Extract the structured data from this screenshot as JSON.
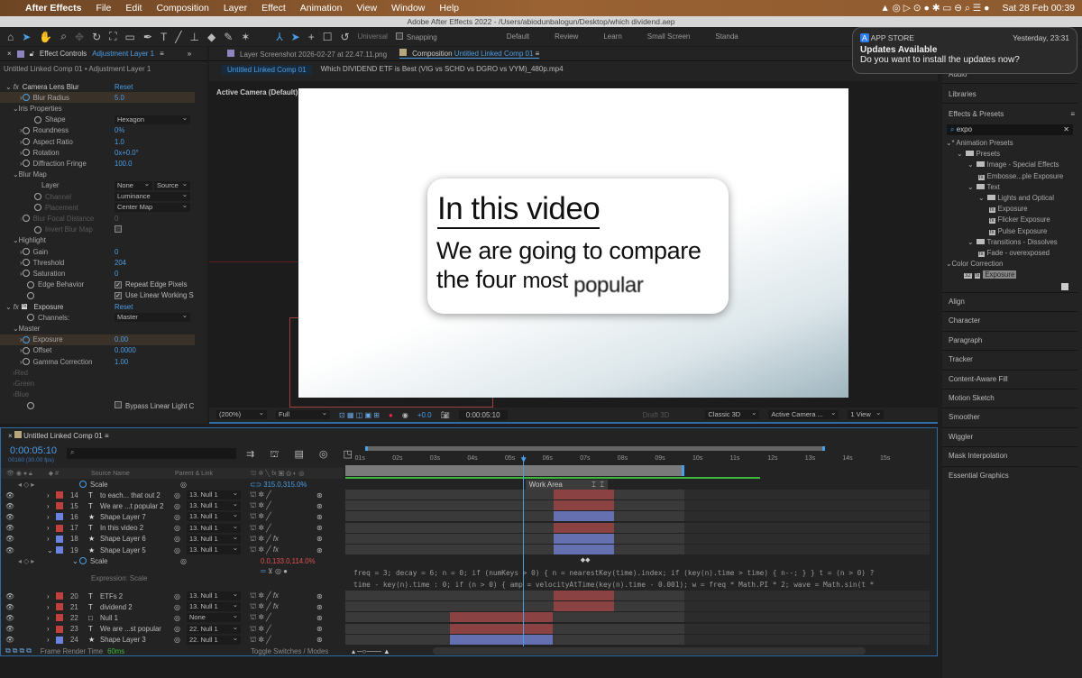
{
  "menubar": {
    "app": "After Effects",
    "items": [
      "File",
      "Edit",
      "Composition",
      "Layer",
      "Effect",
      "Animation",
      "View",
      "Window",
      "Help"
    ],
    "datetime": "Sat 28 Feb  00:39"
  },
  "window_title": "Adobe After Effects 2022 - /Users/abiodunbalogun/Desktop/which dividend.aep",
  "toolbar": {
    "universal": "Universal",
    "snapping": "Snapping",
    "workspaces": [
      "Default",
      "Review",
      "Learn",
      "Small Screen",
      "Standa"
    ]
  },
  "notification": {
    "app": "APP STORE",
    "time": "Yesterday, 23:31",
    "title": "Updates Available",
    "body": "Do you want to install the updates now?"
  },
  "effect_controls": {
    "tab": "Effect Controls",
    "layer": "Adjustment Layer 1",
    "subtitle": "Untitled Linked Comp 01 • Adjustment Layer 1",
    "rows": [
      {
        "label": "Camera Lens Blur",
        "kind": "fx",
        "value": "Reset",
        "indent": 0
      },
      {
        "label": "Blur Radius",
        "value": "5.0",
        "indent": 2,
        "arrow": true,
        "sw": "on",
        "hl": true
      },
      {
        "label": "Iris Properties",
        "kind": "group",
        "indent": 1
      },
      {
        "label": "Shape",
        "dropdown": "Hexagon",
        "indent": 3,
        "sw": true
      },
      {
        "label": "Roundness",
        "value": "0%",
        "indent": 2,
        "arrow": true,
        "sw": true
      },
      {
        "label": "Aspect Ratio",
        "value": "1.0",
        "indent": 2,
        "arrow": true,
        "sw": true
      },
      {
        "label": "Rotation",
        "value": "0x+0.0°",
        "indent": 2,
        "arrow": true,
        "sw": true
      },
      {
        "label": "Diffraction Fringe",
        "value": "100.0",
        "indent": 2,
        "arrow": true,
        "sw": true
      },
      {
        "label": "Blur Map",
        "kind": "group",
        "indent": 1
      },
      {
        "label": "Layer",
        "dropdown": "None",
        "dropdown2": "Source",
        "indent": 4
      },
      {
        "label": "Channel",
        "dropdown": "Luminance",
        "indent": 3,
        "sw": true,
        "dim": true
      },
      {
        "label": "Placement",
        "dropdown": "Center Map",
        "indent": 3,
        "sw": true,
        "dim": true
      },
      {
        "label": "Blur Focal Distance",
        "value": "0",
        "indent": 2,
        "arrow": true,
        "sw": true,
        "dim": true
      },
      {
        "label": "Invert Blur Map",
        "checkbox": "",
        "checked": false,
        "indent": 3,
        "sw": true,
        "dim": true
      },
      {
        "label": "Highlight",
        "kind": "group",
        "indent": 1
      },
      {
        "label": "Gain",
        "value": "0",
        "indent": 2,
        "arrow": true,
        "sw": true
      },
      {
        "label": "Threshold",
        "value": "204",
        "indent": 2,
        "arrow": true,
        "sw": true
      },
      {
        "label": "Saturation",
        "value": "0",
        "indent": 2,
        "arrow": true,
        "sw": true
      },
      {
        "label": "Edge Behavior",
        "checkbox": "Repeat Edge Pixels",
        "checked": true,
        "indent": 2,
        "sw": true
      },
      {
        "label": "",
        "checkbox": "Use Linear Working S",
        "checked": true,
        "indent": 2,
        "sw": true
      },
      {
        "label": "Exposure",
        "kind": "fx",
        "value": "Reset",
        "indent": 0
      },
      {
        "label": "Channels:",
        "dropdown": "Master",
        "indent": 2,
        "sw": true
      },
      {
        "label": "Master",
        "kind": "group",
        "indent": 1
      },
      {
        "label": "Exposure",
        "value": "0.00",
        "indent": 2,
        "arrow": true,
        "sw": "on",
        "hl": true
      },
      {
        "label": "Offset",
        "value": "0.0000",
        "indent": 2,
        "arrow": true,
        "sw": true
      },
      {
        "label": "Gamma Correction",
        "value": "1.00",
        "indent": 2,
        "arrow": true,
        "sw": true
      },
      {
        "label": "Red",
        "kind": "group",
        "collapsed": true,
        "indent": 1,
        "dim": true
      },
      {
        "label": "Green",
        "kind": "group",
        "collapsed": true,
        "indent": 1,
        "dim": true
      },
      {
        "label": "Blue",
        "kind": "group",
        "collapsed": true,
        "indent": 1,
        "dim": true
      },
      {
        "label": "",
        "checkbox": "Bypass Linear Light C",
        "checked": false,
        "indent": 2,
        "sw": true
      }
    ]
  },
  "composition": {
    "layer_tab": "Layer Screenshot 2026-02-27 at 22.47.11.png",
    "tab": "Composition",
    "comp_name": "Untitled Linked Comp 01",
    "breadcrumb": [
      "Untitled Linked Comp 01",
      "Which DIVIDEND ETF is Best (VIG vs SCHD vs DGRO vs VYM)_480p.mp4"
    ],
    "camera_label": "Active Camera (Default)",
    "card": {
      "title": "In this video",
      "line1": "We are going to compare",
      "line2a": "the four ",
      "line2b": "most ",
      "line2c": "popular"
    },
    "bottom": {
      "zoom": "(200%)",
      "resolution": "Full",
      "exposure": "+0.0",
      "timecode": "0:00:05:10",
      "draft3d": "Draft 3D",
      "renderer": "Classic 3D",
      "camera": "Active Camera ...",
      "views": "1 View"
    }
  },
  "right_panel": {
    "audio": "Audio",
    "libraries": "Libraries",
    "effects_presets": "Effects & Presets",
    "search": "expo",
    "tree": [
      {
        "label": "* Animation Presets",
        "level": 0,
        "type": "group"
      },
      {
        "label": "Presets",
        "level": 1,
        "type": "folder"
      },
      {
        "label": "Image - Special Effects",
        "level": 2,
        "type": "folder"
      },
      {
        "label": "Embosse...ple Exposure",
        "level": 3,
        "type": "preset"
      },
      {
        "label": "Text",
        "level": 2,
        "type": "folder"
      },
      {
        "label": "Lights and Optical",
        "level": 3,
        "type": "folder"
      },
      {
        "label": "Exposure",
        "level": 4,
        "type": "preset"
      },
      {
        "label": "Flicker Exposure",
        "level": 4,
        "type": "preset"
      },
      {
        "label": "Pulse Exposure",
        "level": 4,
        "type": "preset"
      },
      {
        "label": "Transitions - Dissolves",
        "level": 2,
        "type": "folder"
      },
      {
        "label": "Fade - overexposed",
        "level": 3,
        "type": "preset"
      },
      {
        "label": "Color Correction",
        "level": 0,
        "type": "group"
      },
      {
        "label": "Exposure",
        "level": 1,
        "type": "effect",
        "selected": true
      }
    ],
    "panels": [
      "Align",
      "Character",
      "Paragraph",
      "Tracker",
      "Content-Aware Fill",
      "Motion Sketch",
      "Smoother",
      "Wiggler",
      "Mask Interpolation",
      "Essential Graphics"
    ]
  },
  "timeline": {
    "tab": "Untitled Linked Comp 01",
    "timecode": "0:00:05:10",
    "frames": "00160 (30.00 fps)",
    "col_source": "Source Name",
    "col_parent": "Parent & Link",
    "current_time_s": 5.33,
    "work_area_end_s": 9.65,
    "work_area_label": "Work Area",
    "ticks": [
      "01s",
      "02s",
      "03s",
      "04s",
      "05s",
      "06s",
      "07s",
      "08s",
      "09s",
      "10s",
      "11s",
      "12s",
      "13s",
      "14s",
      "15s"
    ],
    "scale_row": {
      "label": "Scale",
      "value": "315.0,315.0%"
    },
    "layers": [
      {
        "num": "14",
        "type": "T",
        "name": "to each... that out 2",
        "parent": "13. Null 1",
        "color": "#c0403e",
        "bar": "red",
        "start": 6.15,
        "end": 7.77
      },
      {
        "num": "15",
        "type": "T",
        "name": "We are ...t popular 2",
        "parent": "13. Null 1",
        "color": "#c0403e",
        "bar": "red",
        "start": 6.15,
        "end": 7.77
      },
      {
        "num": "16",
        "type": "★",
        "name": "Shape Layer 7",
        "parent": "13. Null 1",
        "color": "#6b82e0",
        "bar": "blue",
        "start": 6.15,
        "end": 7.77
      },
      {
        "num": "17",
        "type": "T",
        "name": "In this video 2",
        "parent": "13. Null 1",
        "color": "#c0403e",
        "bar": "red",
        "start": 6.15,
        "end": 7.77
      },
      {
        "num": "18",
        "type": "★",
        "name": "Shape Layer 6",
        "parent": "13. Null 1",
        "color": "#6b82e0",
        "bar": "blue",
        "start": 6.15,
        "end": 7.77,
        "fx": true
      },
      {
        "num": "19",
        "type": "★",
        "name": "Shape Layer 5",
        "parent": "13. Null 1",
        "color": "#6b82e0",
        "bar": "blue",
        "start": 6.15,
        "end": 7.77,
        "fx": true,
        "expanded": true
      }
    ],
    "expr_row": {
      "label": "Scale",
      "value": "0.0,133.0,114.0%",
      "expression_label": "Expression: Scale",
      "code": [
        "freq = 3; decay = 6; n = 0; if (numKeys > 0) { n = nearestKey(time).index; if (key(n).time > time) { n--; } } t = (n > 0) ?",
        "time - key(n).time : 0; if (n > 0) { amp = velocityAtTime(key(n).time - 0.001); w = freq * Math.PI * 2; wave = Math.sin(t *"
      ]
    },
    "layers2": [
      {
        "num": "20",
        "type": "T",
        "name": "ETFs 2",
        "parent": "13. Null 1",
        "color": "#c0403e",
        "bar": "red",
        "start": 6.15,
        "end": 7.77,
        "fx": true
      },
      {
        "num": "21",
        "type": "T",
        "name": "dividend 2",
        "parent": "13. Null 1",
        "color": "#c0403e",
        "bar": "red",
        "start": 6.15,
        "end": 7.77,
        "fx": true
      },
      {
        "num": "22",
        "type": "□",
        "name": "Null 1",
        "parent": "None",
        "color": "#c0403e",
        "bar": "red",
        "start": 3.4,
        "end": 6.13
      },
      {
        "num": "23",
        "type": "T",
        "name": "We are ...st popular",
        "parent": "22. Null 1",
        "color": "#c0403e",
        "bar": "red",
        "start": 3.4,
        "end": 6.13
      },
      {
        "num": "24",
        "type": "★",
        "name": "Shape Layer 3",
        "parent": "22. Null 1",
        "color": "#6b82e0",
        "bar": "blue",
        "start": 3.4,
        "end": 6.13
      }
    ],
    "footer": {
      "render_label": "Frame Render Time",
      "render_time": "60ms",
      "toggle": "Toggle Switches / Modes"
    }
  },
  "colors": {
    "accent": "#4a9ee6",
    "bar_red": "#8a4242",
    "bar_blue": "#6470b0",
    "label_red": "#c0403e",
    "label_blue": "#6b82e0"
  }
}
